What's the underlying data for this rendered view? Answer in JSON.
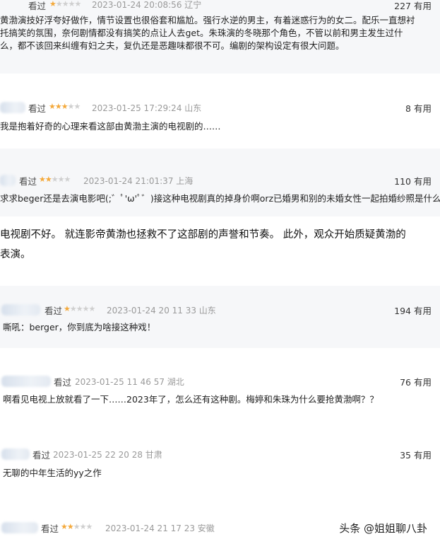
{
  "reviews": [
    {
      "watched": "看过",
      "stars": 1,
      "date": "2023-01-24 20:08:56 辽宁",
      "useful_count": "227",
      "useful_label": "有用",
      "lines": [
        "黄渤演技好浮夸好做作，情节设置也很俗套和尴尬。强行水逆的男主，有着迷惑行为的女二。配乐一直想衬",
        "托搞笑的氛围，奈何剧情都没有搞笑的点让人去get。朱珠演的冬晓那个角色，不管以前和男主发生过什",
        "么，都不该回来纠缠有妇之夫，复仇还是恶趣味都很不可。编剧的架构设定有很大问题。"
      ]
    },
    {
      "watched": "看过",
      "stars": 3,
      "date": "2023-01-25 17:29:24 山东",
      "useful_count": "8",
      "useful_label": "有用",
      "lines": [
        "我是抱着好奇的心理来看这部由黄渤主演的电视剧的……"
      ]
    },
    {
      "watched": "看过",
      "stars": 2,
      "date": "2023-01-24 21:01:37 上海",
      "useful_count": "110",
      "useful_label": "有用",
      "lines": [
        "求求beger还是去演电影吧(;゛ﾟ'ω'ﾟ゛)接这种电视剧真的掉身价啊orz已婚男和别的未婚女性一起拍婚纱照是什么"
      ]
    },
    {
      "watched": "看过",
      "stars": 1,
      "date": "2023-01-24 20 11 33 山东",
      "useful_count": "194",
      "useful_label": "有用",
      "lines": [
        "嘶吼：berger，你到底为啥接这种戏！"
      ]
    },
    {
      "watched": "看过",
      "stars": 0,
      "date": "2023-01-25 11 46 57 湖北",
      "useful_count": "76",
      "useful_label": "有用",
      "lines": [
        "啊看见电视上放就看了一下……2023年了，怎么还有这种剧。梅婷和朱珠为什么要抢黄渤啊？？"
      ]
    },
    {
      "watched": "看过",
      "stars": 0,
      "date": "2023-01-25 22 20 28 甘肃",
      "useful_count": "35",
      "useful_label": "有用",
      "lines": [
        "无聊的中年生活的yy之作"
      ]
    },
    {
      "watched": "看过",
      "stars": 2,
      "date": "2023-01-24 21 17 23 安徽",
      "useful_count": "",
      "useful_label": "",
      "lines": []
    }
  ],
  "article": [
    "电视剧不好。 就连影帝黄渤也拯救不了这部剧的声誉和节奏。 此外，观众开始质疑黄渤的",
    "表演。"
  ],
  "watermark": "头条 @姐姐聊八卦",
  "colors": {
    "star_on": "#f4a93b",
    "star_off": "#cfcfcf",
    "card_tint": "#f6f7f9"
  }
}
